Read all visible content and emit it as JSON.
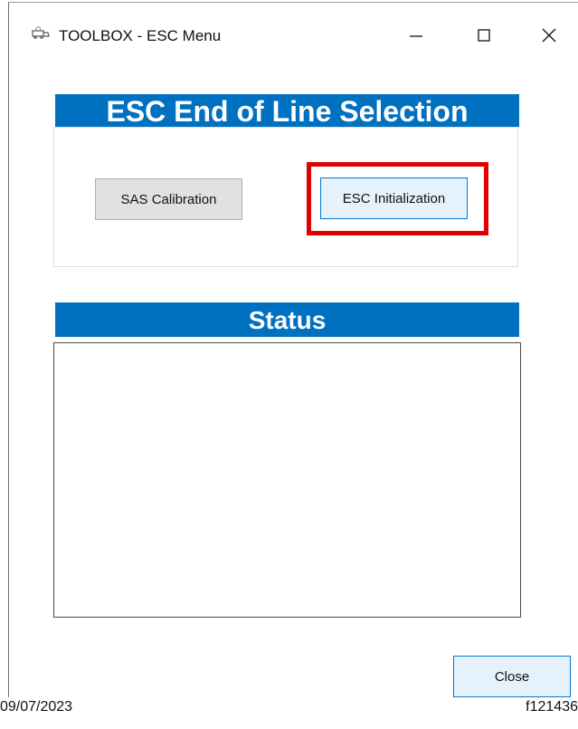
{
  "window": {
    "title": "TOOLBOX - ESC Menu",
    "controls": [
      "minimize-icon",
      "maximize-icon",
      "close-icon"
    ]
  },
  "selection": {
    "heading": "ESC End of Line Selection",
    "buttons": {
      "sas_label": "SAS Calibration",
      "esc_label": "ESC Initialization"
    },
    "highlighted": "ESC Initialization"
  },
  "status": {
    "heading": "Status",
    "content": ""
  },
  "footer": {
    "close_label": "Close"
  },
  "caption": {
    "date": "09/07/2023",
    "figure_id": "f121436"
  },
  "colors": {
    "banner": "#0070c0",
    "highlight": "#e00000",
    "button_focus_border": "#0078d7"
  }
}
